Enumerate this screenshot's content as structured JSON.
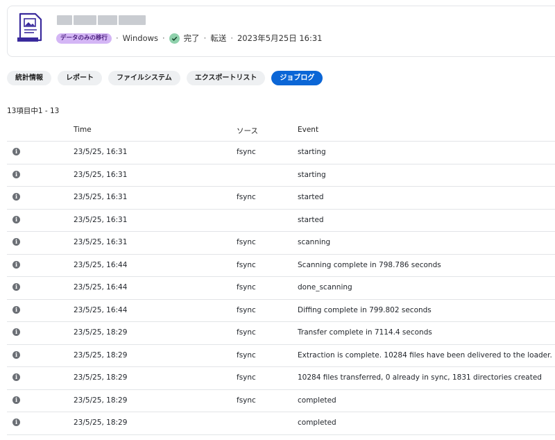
{
  "header": {
    "badge": "データのみの移行",
    "platform": "Windows",
    "status": "完了",
    "transfer_label": "転送",
    "datetime": "2023年5月25日 16:31",
    "status_color": "#8fd1ac",
    "badge_color": "#d4b6f5"
  },
  "tabs": [
    {
      "label": "統計情報",
      "active": false
    },
    {
      "label": "レポート",
      "active": false
    },
    {
      "label": "ファイルシステム",
      "active": false
    },
    {
      "label": "エクスポートリスト",
      "active": false
    },
    {
      "label": "ジョブログ",
      "active": true
    }
  ],
  "count_text": "13項目中1 - 13",
  "table": {
    "columns": {
      "time": "Time",
      "source": "ソース",
      "event": "Event"
    },
    "rows": [
      {
        "icon": "info-icon",
        "time": "23/5/25, 16:31",
        "source": "fsync",
        "event": "starting"
      },
      {
        "icon": "info-icon",
        "time": "23/5/25, 16:31",
        "source": "",
        "event": "starting"
      },
      {
        "icon": "info-icon",
        "time": "23/5/25, 16:31",
        "source": "fsync",
        "event": "started"
      },
      {
        "icon": "info-icon",
        "time": "23/5/25, 16:31",
        "source": "",
        "event": "started"
      },
      {
        "icon": "info-icon",
        "time": "23/5/25, 16:31",
        "source": "fsync",
        "event": "scanning"
      },
      {
        "icon": "info-icon",
        "time": "23/5/25, 16:44",
        "source": "fsync",
        "event": "Scanning complete in 798.786 seconds"
      },
      {
        "icon": "info-icon",
        "time": "23/5/25, 16:44",
        "source": "fsync",
        "event": "done_scanning"
      },
      {
        "icon": "info-icon",
        "time": "23/5/25, 16:44",
        "source": "fsync",
        "event": "Diffing complete in 799.802 seconds"
      },
      {
        "icon": "info-icon",
        "time": "23/5/25, 18:29",
        "source": "fsync",
        "event": "Transfer complete in 7114.4 seconds"
      },
      {
        "icon": "info-icon",
        "time": "23/5/25, 18:29",
        "source": "fsync",
        "event": "Extraction is complete. 10284 files have been delivered to the loader."
      },
      {
        "icon": "info-icon",
        "time": "23/5/25, 18:29",
        "source": "fsync",
        "event": "10284 files transferred, 0 already in sync, 1831 directories created"
      },
      {
        "icon": "info-icon",
        "time": "23/5/25, 18:29",
        "source": "fsync",
        "event": "completed"
      },
      {
        "icon": "info-icon",
        "time": "23/5/25, 18:29",
        "source": "",
        "event": "completed"
      }
    ]
  },
  "colors": {
    "accent": "#0b66d6",
    "icon_purple": "#3a2a9c"
  }
}
